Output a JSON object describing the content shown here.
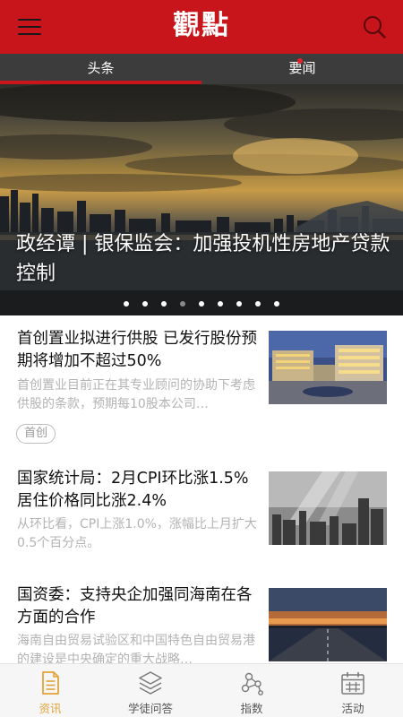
{
  "header": {
    "logo": "觀點",
    "menu_icon": "hamburger-menu-icon",
    "search_icon": "search-icon",
    "background": "#c8141b"
  },
  "tabs": [
    {
      "label": "头条",
      "active": true
    },
    {
      "label": "要闻",
      "active": false,
      "has_new": true
    }
  ],
  "carousel": {
    "title": "政经谭 | 银保监会：加强投机性房地产贷款控制",
    "slide_count": 9,
    "active_index": 3
  },
  "news": [
    {
      "title": "首创置业拟进行供股 已发行股份预期将增加不超过50%",
      "summary": "首创置业目前正在其专业顾问的协助下考虑供股的条款，预期每10股本公司…",
      "tag": "首创",
      "thumb": "office-building-night-photo"
    },
    {
      "title": "国家统计局：2月CPI环比涨1.5% 居住价格同比涨2.4%",
      "summary": "从环比看，CPI上涨1.0%，涨幅比上月扩大0.5个百分点。",
      "thumb": "city-skyline-sunbeam-photo"
    },
    {
      "title": "国资委：支持央企加强同海南在各方面的合作",
      "summary": "海南自由贸易试验区和中国特色自由贸易港的建设是中央确定的重大战略…",
      "thumb": "sunset-highway-photo"
    }
  ],
  "bottom_nav": [
    {
      "label": "资讯",
      "icon": "document-icon",
      "active": true
    },
    {
      "label": "学徒问答",
      "icon": "layers-icon",
      "active": false
    },
    {
      "label": "指数",
      "icon": "nodes-icon",
      "active": false
    },
    {
      "label": "活动",
      "icon": "calendar-icon",
      "active": false
    }
  ],
  "colors": {
    "brand_red": "#c8141b",
    "tab_bar": "#3c3c3c",
    "active_nav": "#e3a338"
  }
}
